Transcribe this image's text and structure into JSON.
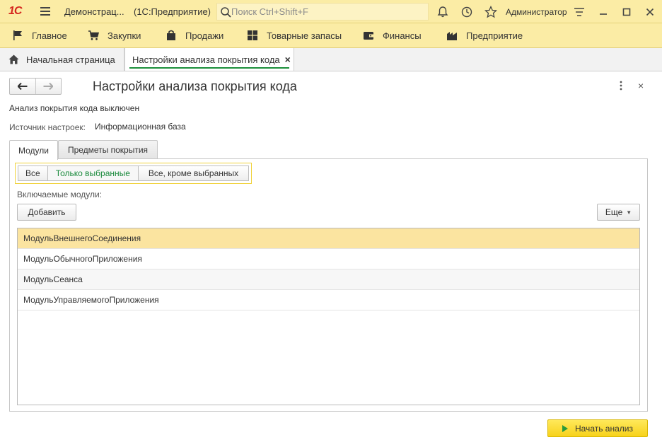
{
  "titlebar": {
    "logo_text": "1С",
    "app_title": "Демонстрац...",
    "platform": "(1С:Предприятие)",
    "search_placeholder": "Поиск Ctrl+Shift+F",
    "user_name": "Администратор",
    "icons": [
      "bell-icon",
      "history-icon",
      "star-icon",
      "settings-icon",
      "minimize-icon",
      "maximize-icon",
      "close-icon"
    ]
  },
  "sections": [
    {
      "label": "Главное",
      "icon": "flag-icon"
    },
    {
      "label": "Закупки",
      "icon": "cart-icon"
    },
    {
      "label": "Продажи",
      "icon": "bag-icon"
    },
    {
      "label": "Товарные запасы",
      "icon": "grid-icon"
    },
    {
      "label": "Финансы",
      "icon": "wallet-icon"
    },
    {
      "label": "Предприятие",
      "icon": "factory-icon"
    }
  ],
  "open_tabs": {
    "home": "Начальная страница",
    "active": "Настройки анализа покрытия кода",
    "close_glyph": "×"
  },
  "form": {
    "title": "Настройки анализа покрытия кода",
    "close_glyph": "×",
    "status_text": "Анализ покрытия кода выключен",
    "source_label": "Источник настроек:",
    "source_value": "Информационная база",
    "tabs": [
      "Модули",
      "Предметы покрытия"
    ],
    "selected_tab": "Модули",
    "filter_options": [
      "Все",
      "Только выбранные",
      "Все, кроме выбранных"
    ],
    "selected_filter": "Только выбранные",
    "list_label": "Включаемые модули:",
    "add_button": "Добавить",
    "more_button": "Еще",
    "modules": [
      "МодульВнешнегоСоединения",
      "МодульОбычногоПриложения",
      "МодульСеанса",
      "МодульУправляемогоПриложения"
    ],
    "start_button": "Начать анализ"
  },
  "colors": {
    "titlebar_bg": "#fbeca5",
    "accent_green": "#1b8f3a",
    "selected_row": "#fbe4a0",
    "primary_button": "#f7d21b",
    "logo_red": "#d5261e"
  }
}
